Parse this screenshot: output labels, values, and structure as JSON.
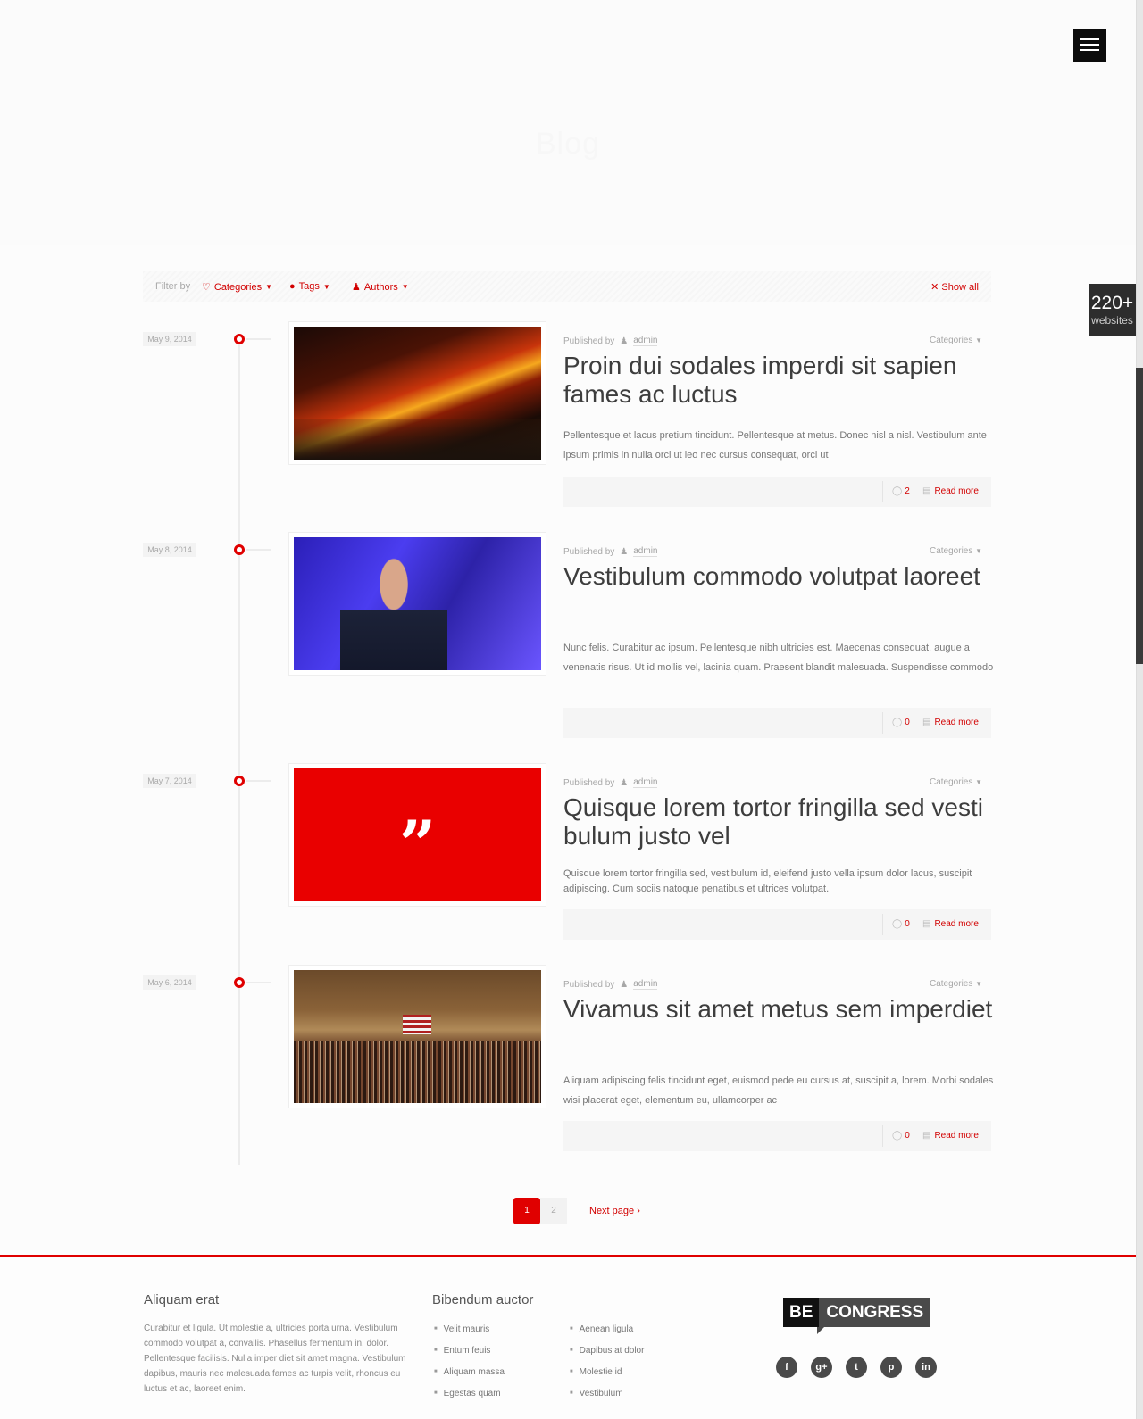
{
  "header": {
    "title": "Blog",
    "menu_icon": "hamburger-icon"
  },
  "badge": {
    "number": "220+",
    "label": "websites"
  },
  "filter": {
    "label": "Filter by",
    "categories": "Categories",
    "tags": "Tags",
    "authors": "Authors",
    "show_all": "Show all",
    "icons": {
      "categories": "tag-outline-icon",
      "tags": "tag-icon",
      "authors": "user-icon",
      "show_all": "close-icon"
    }
  },
  "accent_color": "#e00000",
  "posts": [
    {
      "date": "May 9, 2014",
      "published_by": "Published by",
      "author": "admin",
      "categories": "Categories",
      "title": "Proin dui sodales imperdi sit sapien fames ac luctus",
      "excerpt": "Pellentesque et lacus pretium tincidunt. Pellentesque at metus. Donec nisl a nisl. Vestibulum ante ipsum primis in nulla orci ut leo nec cursus consequat, orci ut",
      "comments": "2",
      "read_more": "Read more",
      "image": "night-street-light-trails"
    },
    {
      "date": "May 8, 2014",
      "published_by": "Published by",
      "author": "admin",
      "categories": "Categories",
      "title": "Vestibulum commodo volutpat laoreet",
      "excerpt": "Nunc felis. Curabitur ac ipsum. Pellentesque nibh ultricies est. Maecenas consequat, augue a venenatis risus. Ut id mollis vel, lacinia quam. Praesent blandit malesuada. Suspendisse commodo",
      "comments": "0",
      "read_more": "Read more",
      "image": "speaker-at-podium"
    },
    {
      "date": "May 7, 2014",
      "published_by": "Published by",
      "author": "admin",
      "categories": "Categories",
      "title": "Quisque lorem tortor fringilla sed vesti bulum justo vel",
      "excerpt": "Quisque lorem tortor fringilla sed, vestibulum id, eleifend justo vella ipsum dolor lacus, suscipit adipiscing. Cum sociis natoque penatibus et ultrices volutpat.",
      "comments": "0",
      "read_more": "Read more",
      "image": "quote-icon"
    },
    {
      "date": "May 6, 2014",
      "published_by": "Published by",
      "author": "admin",
      "categories": "Categories",
      "title": "Vivamus sit amet metus sem imperdiet",
      "excerpt": "Aliquam adipiscing felis tincidunt eget, euismod pede eu cursus at, suscipit a, lorem. Morbi sodales wisi placerat eget, elementum eu, ullamcorper ac",
      "comments": "0",
      "read_more": "Read more",
      "image": "congress-chamber"
    }
  ],
  "pagination": {
    "pages": [
      "1",
      "2"
    ],
    "current": "1",
    "next": "Next page"
  },
  "footer": {
    "col1": {
      "title": "Aliquam erat",
      "text": "Curabitur et ligula. Ut molestie a, ultricies porta urna. Vestibulum commodo volutpat a, convallis. Phasellus fermentum in, dolor. Pellentesque facilisis. Nulla imper diet sit amet magna. Vestibulum dapibus, mauris nec malesuada fames ac turpis velit, rhoncus eu luctus et ac, laoreet enim."
    },
    "col2": {
      "title": "Bibendum auctor",
      "list_a": [
        "Velit mauris",
        "Entum feuis",
        "Aliquam massa",
        "Egestas quam"
      ],
      "list_b": [
        "Aenean ligula",
        "Dapibus at dolor",
        "Molestie id",
        "Vestibulum"
      ]
    },
    "logo": {
      "part1": "BE",
      "part2": "CONGRESS"
    },
    "socials": [
      {
        "icon": "facebook-icon",
        "glyph": "f"
      },
      {
        "icon": "google-plus-icon",
        "glyph": "g+"
      },
      {
        "icon": "twitter-icon",
        "glyph": "t"
      },
      {
        "icon": "pinterest-icon",
        "glyph": "p"
      },
      {
        "icon": "linkedin-icon",
        "glyph": "in"
      }
    ]
  }
}
